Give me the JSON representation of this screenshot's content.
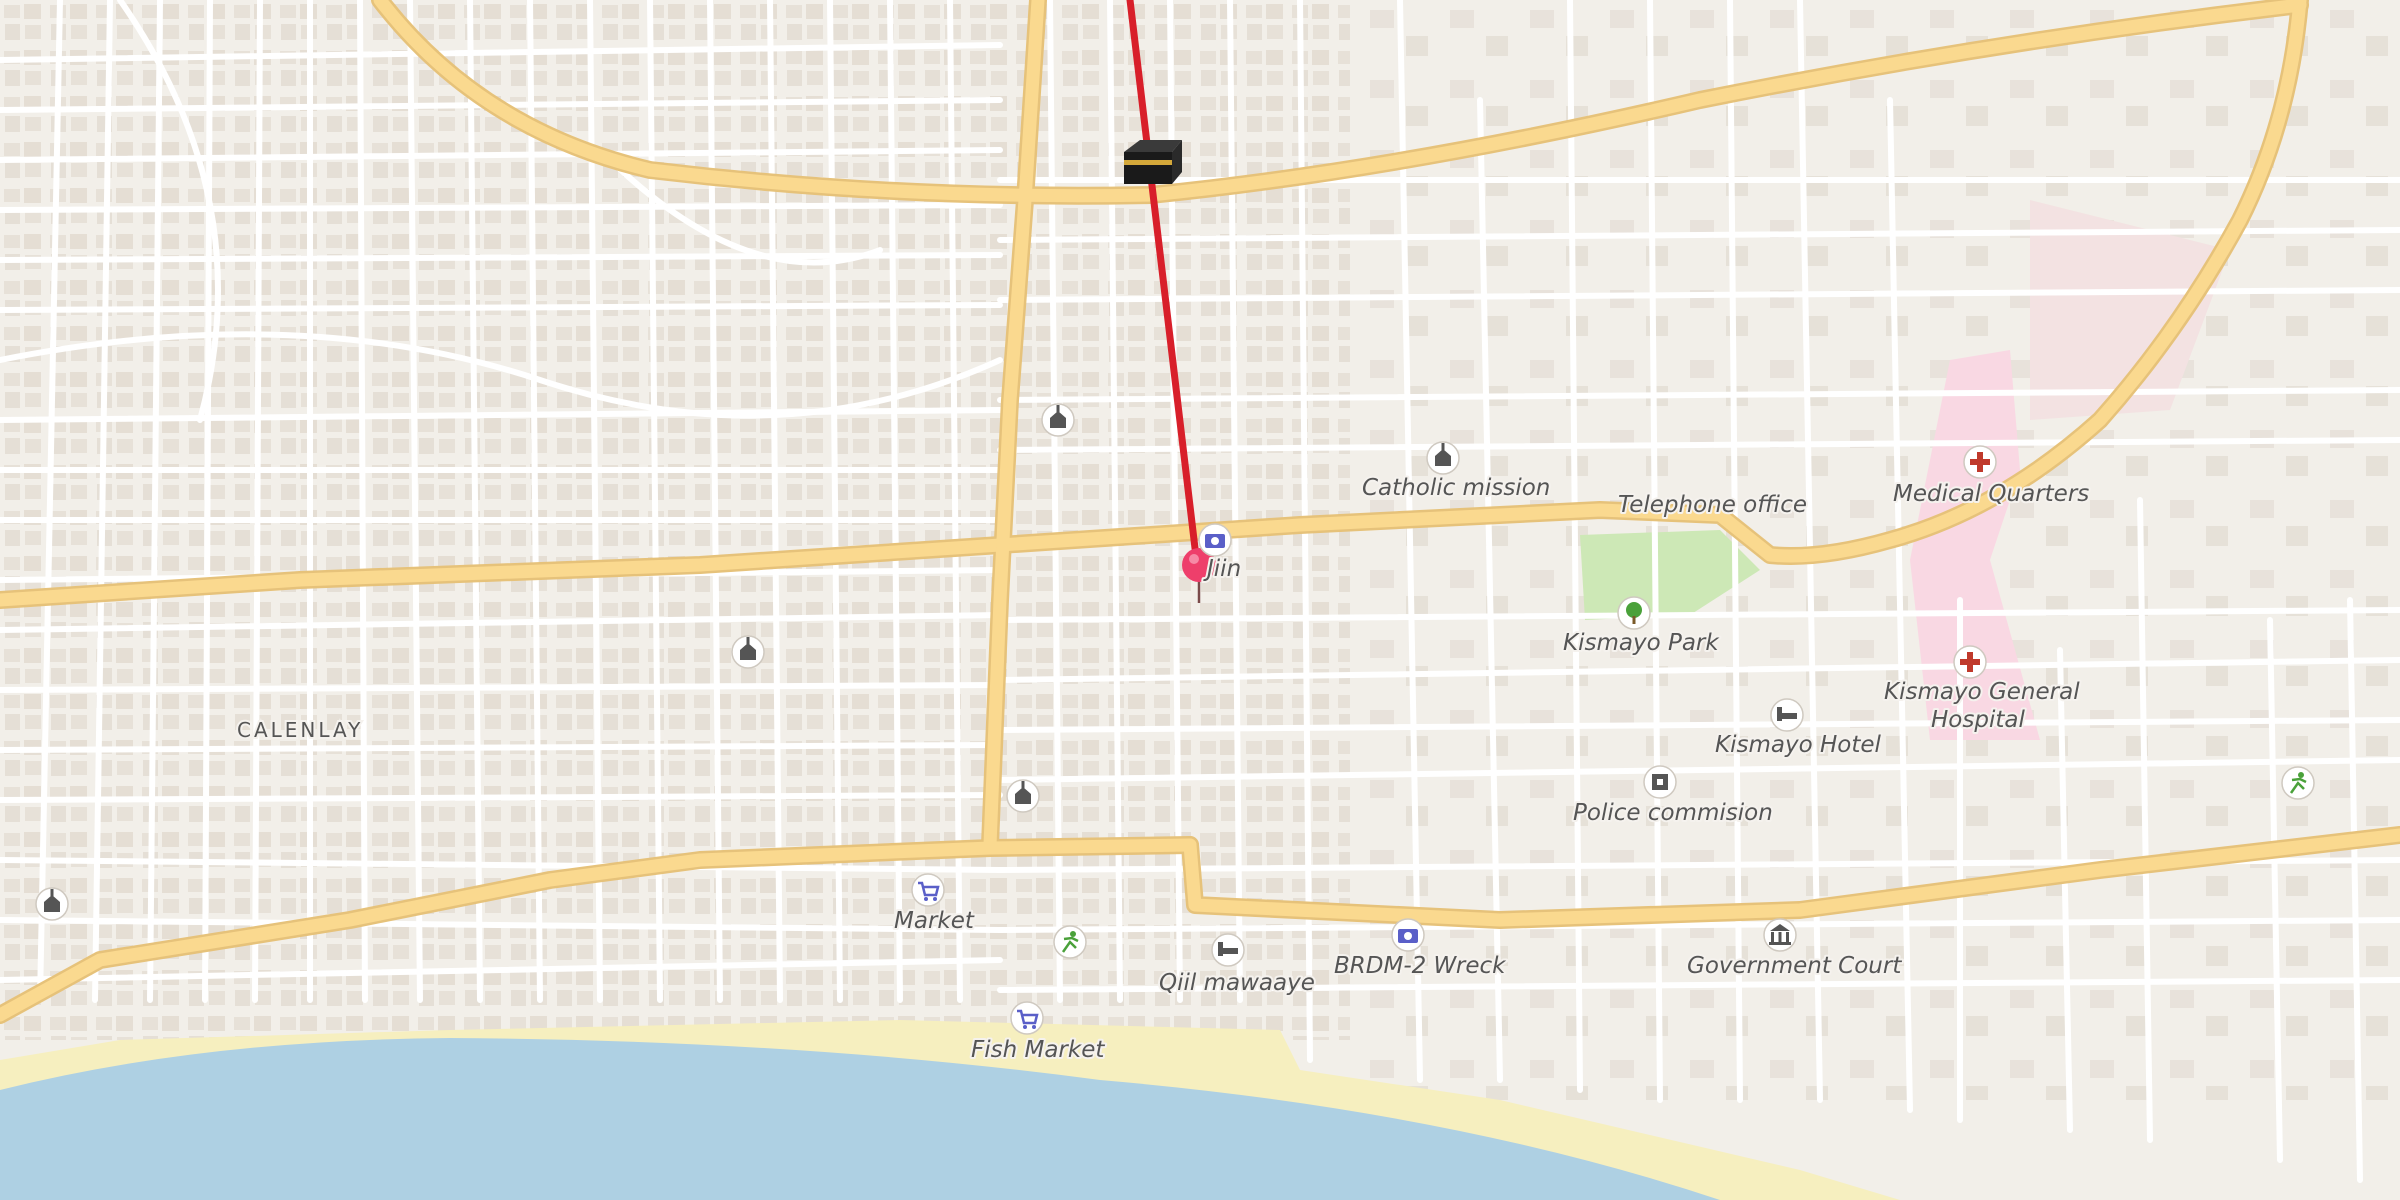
{
  "map": {
    "area_label": "CALENLAY",
    "pois": [
      {
        "id": "catholic-mission",
        "label": "Catholic mission",
        "icon": "church-icon"
      },
      {
        "id": "telephone-office",
        "label": "Telephone office",
        "icon": ""
      },
      {
        "id": "medical-quarters",
        "label": "Medical Quarters",
        "icon": "hospital-icon"
      },
      {
        "id": "kismayo-park",
        "label": "Kismayo Park",
        "icon": "tree-icon"
      },
      {
        "id": "kismayo-general-hospital",
        "label_line1": "Kismayo General",
        "label_line2": "Hospital",
        "icon": "hospital-icon"
      },
      {
        "id": "kismayo-hotel",
        "label": "Kismayo Hotel",
        "icon": "bed-icon"
      },
      {
        "id": "police-commision",
        "label": "Police commision",
        "icon": "police-icon"
      },
      {
        "id": "government-court",
        "label": "Government Court",
        "icon": "courthouse-icon"
      },
      {
        "id": "brdm-2-wreck",
        "label": "BRDM-2 Wreck",
        "icon": "camera-icon"
      },
      {
        "id": "qiil-mawaaye",
        "label": "Qiil mawaaye",
        "icon": "bed-icon"
      },
      {
        "id": "fish-market",
        "label": "Fish Market",
        "icon": "cart-icon"
      },
      {
        "id": "market",
        "label": "Market",
        "icon": "cart-icon"
      },
      {
        "id": "jiin",
        "label": "Jiin",
        "icon": "camera-icon"
      }
    ],
    "colors": {
      "land": "#f2efe9",
      "major_road": "#fad98f",
      "major_road_casing": "#e6c27a",
      "minor_road": "#ffffff",
      "water": "#aed0e3",
      "beach": "#f6efbf",
      "park": "#cde8b6",
      "hospital_area": "#f9dbe4",
      "qibla_line": "#d81f2a",
      "pin": "#ee3f6b"
    }
  }
}
